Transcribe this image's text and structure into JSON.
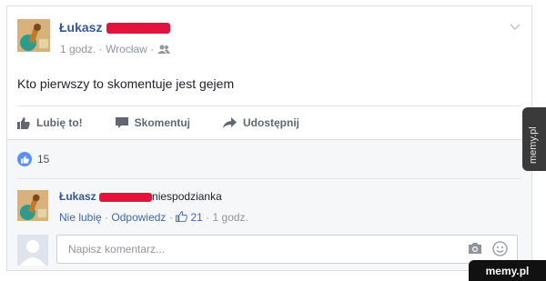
{
  "post": {
    "author": "Łukasz",
    "time": "1 godz.",
    "location": "Wrocław",
    "privacy_icon": "friends-icon",
    "text": "Kto pierwszy to skomentuje jest gejem"
  },
  "actions": {
    "like_label": "Lubię to!",
    "comment_label": "Skomentuj",
    "share_label": "Udostępnij"
  },
  "likes": {
    "count": "15",
    "icon": "like-icon"
  },
  "comment": {
    "author": "Łukasz",
    "text": "niespodzianka",
    "unlike_label": "Nie lubię",
    "reply_label": "Odpowiedz",
    "like_count": "21",
    "time": "1 godz."
  },
  "composer": {
    "placeholder": "Napisz komentarz..."
  },
  "watermark": {
    "side": "memy.pl",
    "corner": "memy.pl"
  },
  "colors": {
    "link": "#365899",
    "redaction": "#e0143c",
    "like": "#5890ff",
    "muted": "#90949c"
  }
}
